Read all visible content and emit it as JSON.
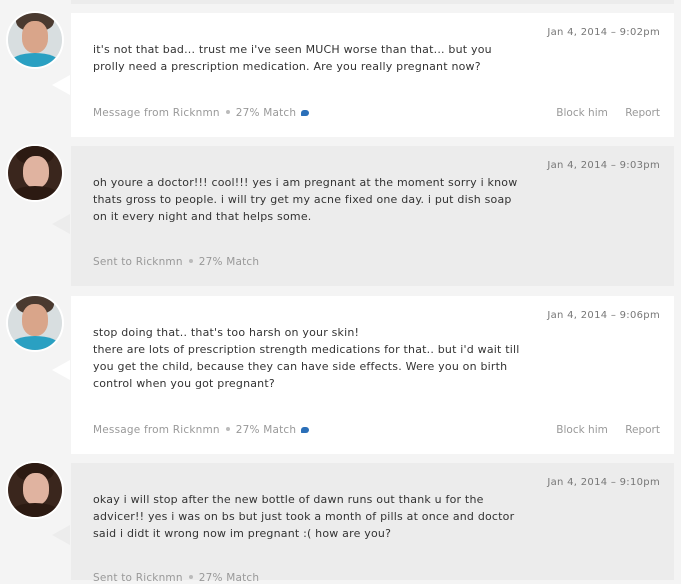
{
  "messages": [
    {
      "date": "Jan 4, 2014 – 9:02pm",
      "lines": [
        "it's not that bad... trust me i've seen MUCH worse than that... but you prolly need a prescription medication. Are you really pregnant now?"
      ],
      "footer_prefix": "Message from Ricknmn",
      "match": "27% Match",
      "block_label": "Block him",
      "report_label": "Report"
    },
    {
      "date": "Jan 4, 2014 – 9:03pm",
      "lines": [
        "oh youre a doctor!!! cool!!! yes i am pregnant at the moment sorry i know thats gross to people. i will try get my acne fixed one day. i put dish soap on it every night and that helps some."
      ],
      "footer_prefix": "Sent to Ricknmn",
      "match": "27% Match"
    },
    {
      "date": "Jan 4, 2014 – 9:06pm",
      "lines": [
        "stop doing that.. that's too harsh on your skin!",
        "there are lots of prescription strength medications for that.. but i'd wait till you get the child, because they can have side effects. Were you on birth control when you got pregnant?"
      ],
      "footer_prefix": "Message from Ricknmn",
      "match": "27% Match",
      "block_label": "Block him",
      "report_label": "Report"
    },
    {
      "date": "Jan 4, 2014 – 9:10pm",
      "lines": [
        "okay i will stop after the new bottle of dawn runs out thank u for the advicer!! yes i was on bs but just took a month of pills at once and doctor said i didt it wrong now im pregnant :( how are you?"
      ],
      "footer_prefix": "Sent to Ricknmn",
      "match": "27% Match"
    }
  ]
}
